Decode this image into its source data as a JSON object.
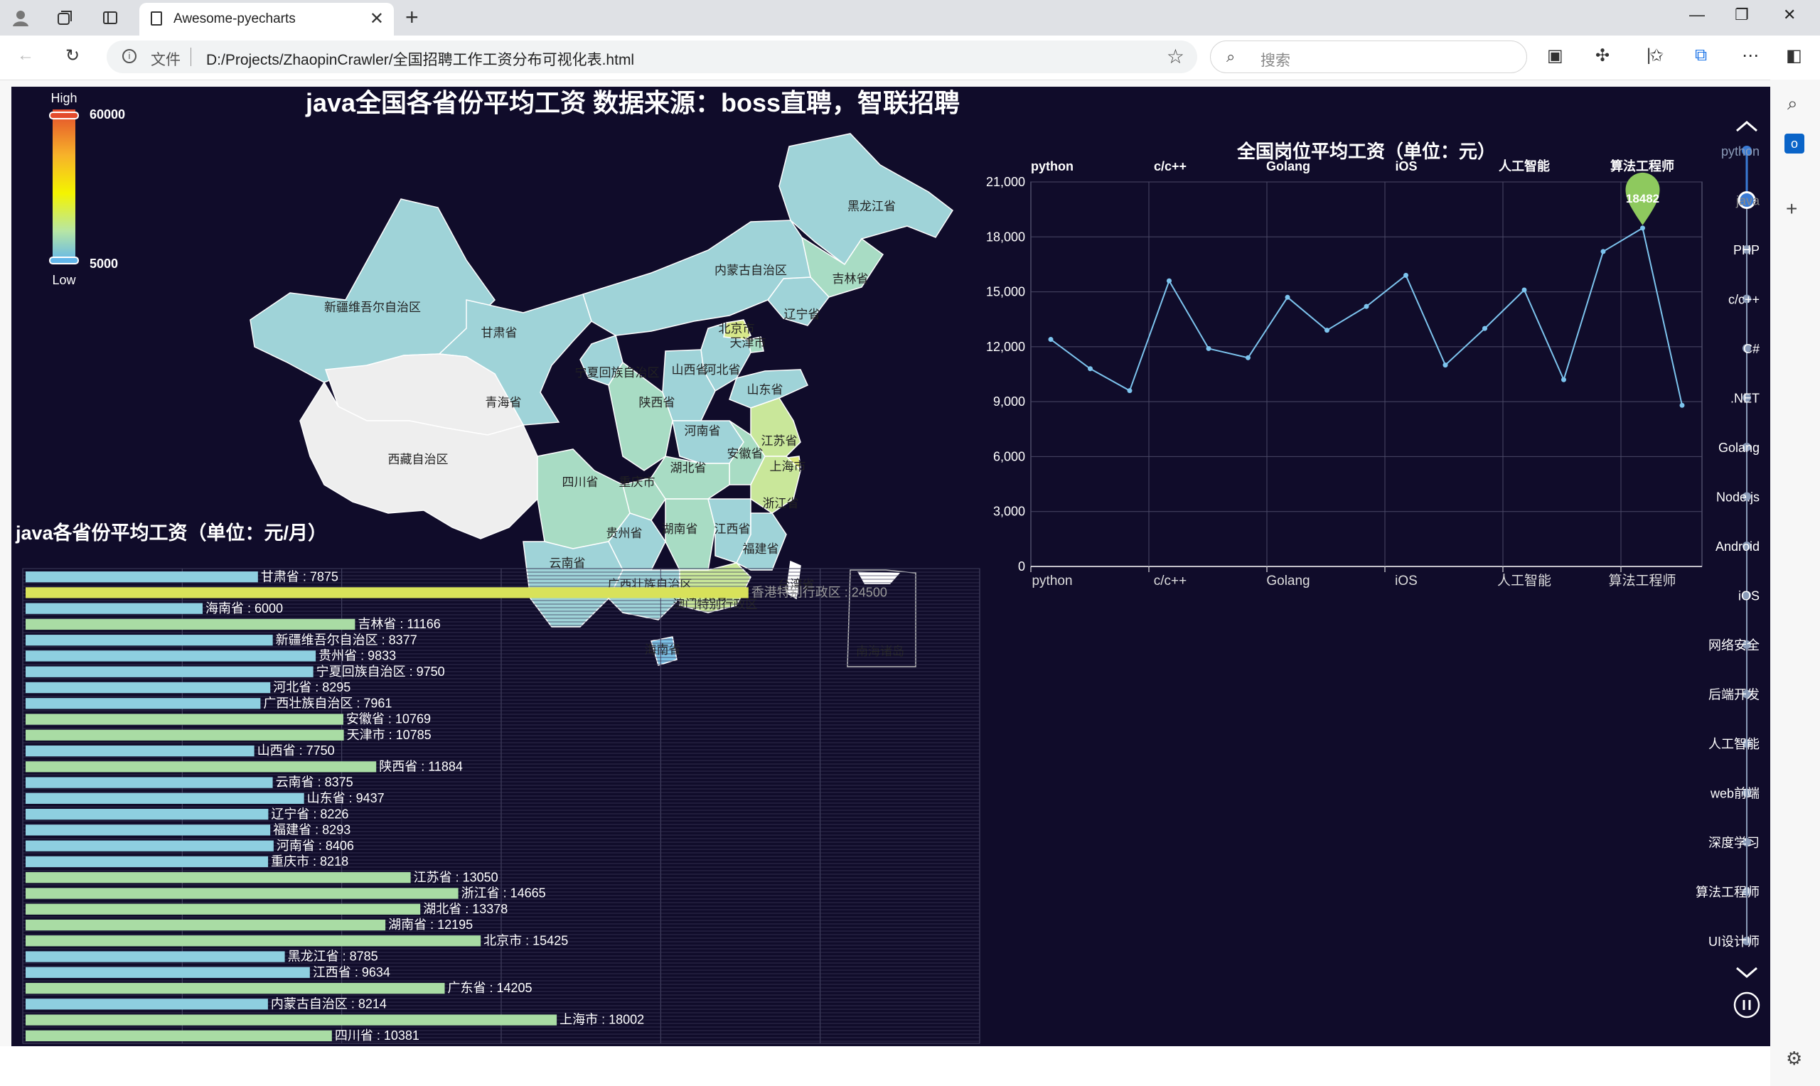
{
  "browser": {
    "tab_title": "Awesome-pyecharts",
    "address_label": "文件",
    "url": "D:/Projects/ZhaopinCrawler/全国招聘工作工资分布可视化表.html",
    "search_placeholder": "搜索"
  },
  "page": {
    "title": "java全国各省份平均工资 数据来源：boss直聘，智联招聘",
    "visual_map": {
      "high_label": "High",
      "low_label": "Low",
      "max": "60000",
      "min": "5000"
    },
    "map": {
      "regions": [
        "黑龙江省",
        "吉林省",
        "辽宁省",
        "内蒙古自治区",
        "新疆维吾尔自治区",
        "甘肃省",
        "北京市",
        "天津市",
        "河北省",
        "山西省",
        "宁夏回族自治区",
        "山东省",
        "陕西省",
        "青海省",
        "西藏自治区",
        "河南省",
        "江苏省",
        "安徽省",
        "上海市",
        "四川省",
        "重庆市",
        "湖北省",
        "浙江省",
        "贵州省",
        "湖南省",
        "江西省",
        "福建省",
        "云南省",
        "广西壮族自治区",
        "广东省",
        "澳门特别行政区",
        "台湾省",
        "海南省",
        "南海诸岛"
      ]
    },
    "bar_title": "java各省份平均工资（单位：元/月）"
  },
  "chart_data": [
    {
      "type": "line",
      "title": "全国岗位平均工资（单位：元）",
      "x_categories_top": [
        "python",
        "c/c++",
        "Golang",
        "iOS",
        "人工智能",
        "算法工程师"
      ],
      "x_categories_bottom": [
        "python",
        "c/c++",
        "Golang",
        "iOS",
        "人工智能",
        "算法工程师"
      ],
      "y_ticks": [
        "21,000",
        "18,000",
        "15,000",
        "12,000",
        "9,000",
        "6,000",
        "3,000",
        "0"
      ],
      "ylim": [
        0,
        21000
      ],
      "values": [
        12400,
        10800,
        9600,
        15600,
        11900,
        11400,
        14700,
        12900,
        14200,
        15900,
        11000,
        13000,
        15100,
        10200,
        17200,
        18482,
        8800
      ],
      "max_label": "18482",
      "colors": {
        "line": "#7dc4ee",
        "pin": "#8ec95e"
      }
    },
    {
      "type": "bar",
      "orientation": "horizontal",
      "title": "java各省份平均工资（单位：元/月）",
      "categories": [
        "甘肃省",
        "香港特别行政区",
        "海南省",
        "吉林省",
        "新疆维吾尔自治区",
        "贵州省",
        "宁夏回族自治区",
        "河北省",
        "广西壮族自治区",
        "安徽省",
        "天津市",
        "山西省",
        "陕西省",
        "云南省",
        "山东省",
        "辽宁省",
        "福建省",
        "河南省",
        "重庆市",
        "江苏省",
        "浙江省",
        "湖北省",
        "湖南省",
        "北京市",
        "黑龙江省",
        "江西省",
        "广东省",
        "内蒙古自治区",
        "上海市",
        "四川省"
      ],
      "values": [
        7875,
        24500,
        6000,
        11166,
        8377,
        9833,
        9750,
        8295,
        7961,
        10769,
        10785,
        7750,
        11884,
        8375,
        9437,
        8226,
        8293,
        8406,
        8218,
        13050,
        14665,
        13378,
        12195,
        15425,
        8785,
        9634,
        14205,
        8214,
        18002,
        10381
      ],
      "labels": [
        "甘肃省 : 7875",
        "香港特别行政区 : 24500",
        "海南省 : 6000",
        "吉林省 : 11166",
        "新疆维吾尔自治区 : 8377",
        "贵州省 : 9833",
        "宁夏回族自治区 : 9750",
        "河北省 : 8295",
        "广西壮族自治区 : 7961",
        "安徽省 : 10769",
        "天津市 : 10785",
        "山西省 : 7750",
        "陕西省 : 11884",
        "云南省 : 8375",
        "山东省 : 9437",
        "辽宁省 : 8226",
        "福建省 : 8293",
        "河南省 : 8406",
        "重庆市 : 8218",
        "江苏省 : 13050",
        "浙江省 : 14665",
        "湖北省 : 13378",
        "湖南省 : 12195",
        "北京市 : 15425",
        "黑龙江省 : 8785",
        "江西省 : 9634",
        "广东省 : 14205",
        "内蒙古自治区 : 8214",
        "上海市 : 18002",
        "四川省 : 10381"
      ]
    }
  ],
  "timeline": {
    "items": [
      "python",
      "java",
      "PHP",
      "c/c++",
      "C#",
      ".NET",
      "Golang",
      "Node.js",
      "Android",
      "iOS",
      "网络安全",
      "后端开发",
      "人工智能",
      "web前端",
      "深度学习",
      "算法工程师",
      "UI设计师"
    ],
    "current": "java",
    "colors": {
      "active": "#3a7bd5",
      "dot": "#8a9bb8"
    }
  }
}
